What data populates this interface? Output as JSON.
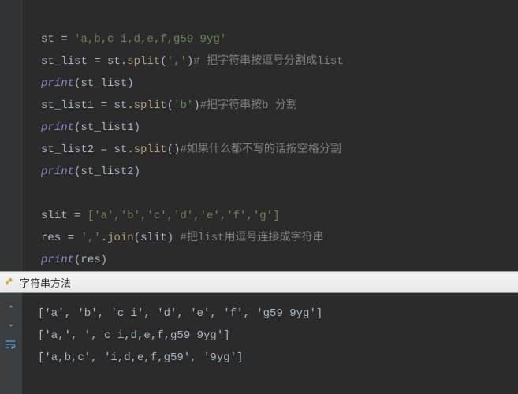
{
  "code": {
    "l1": {
      "var": "st",
      "eq": " = ",
      "str": "'a,b,c i,d,e,f,g59 9yg'"
    },
    "l2": {
      "var": "st_list",
      "eq": " = ",
      "obj": "st",
      "dot": ".",
      "fn": "split",
      "args": "','",
      "com": "# 把字符串按逗号分割成list"
    },
    "l3": {
      "bi": "print",
      "args": "st_list"
    },
    "l4": {
      "var": "st_list1",
      "eq": " = ",
      "obj": "st",
      "dot": ".",
      "fn": "split",
      "args": "'b'",
      "com": "#把字符串按b 分割"
    },
    "l5": {
      "bi": "print",
      "args": "st_list1"
    },
    "l6": {
      "var": "st_list2",
      "eq": " = ",
      "obj": "st",
      "dot": ".",
      "fn": "split",
      "args": "",
      "com": "#如果什么都不写的话按空格分割"
    },
    "l7": {
      "bi": "print",
      "args": "st_list2"
    },
    "l9": {
      "var": "slit",
      "eq": " = ",
      "list": "['a','b','c','d','e','f','g']"
    },
    "l10": {
      "var": "res",
      "eq": " = ",
      "str": "','",
      "dot": ".",
      "fn": "join",
      "args": "slit",
      "com": " #把list用逗号连接成字符串"
    },
    "l11": {
      "bi": "print",
      "args": "res"
    }
  },
  "tab": {
    "label": "字符串方法"
  },
  "output": {
    "o1": "['a', 'b', 'c i', 'd', 'e', 'f', 'g59 9yg']",
    "o2": "['a,', ', c i,d,e,f,g59 9yg']",
    "o3": "['a,b,c', 'i,d,e,f,g59', '9yg']"
  }
}
